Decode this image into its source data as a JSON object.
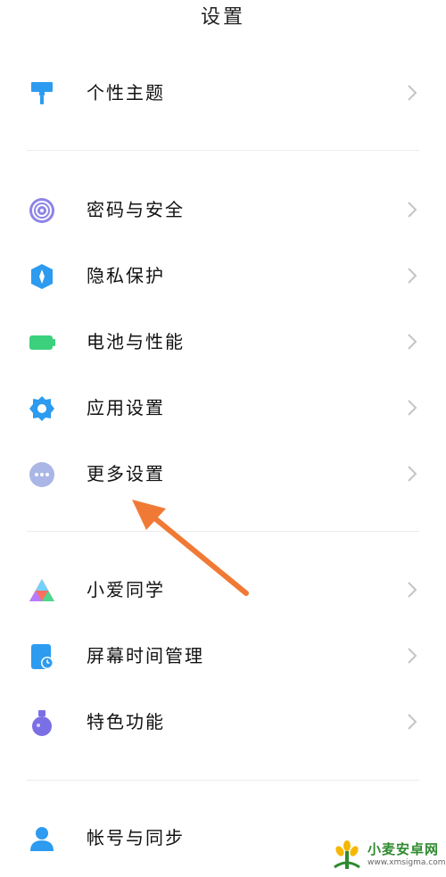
{
  "header": {
    "title": "设置"
  },
  "sections": [
    {
      "items": [
        {
          "label": "个性主题",
          "icon": "paint-brush-icon"
        }
      ]
    },
    {
      "items": [
        {
          "label": "密码与安全",
          "icon": "fingerprint-icon"
        },
        {
          "label": "隐私保护",
          "icon": "privacy-shield-icon"
        },
        {
          "label": "电池与性能",
          "icon": "battery-icon"
        },
        {
          "label": "应用设置",
          "icon": "gear-icon"
        },
        {
          "label": "更多设置",
          "icon": "more-dots-icon"
        }
      ]
    },
    {
      "items": [
        {
          "label": "小爱同学",
          "icon": "xiaoai-icon"
        },
        {
          "label": "屏幕时间管理",
          "icon": "screen-time-icon"
        },
        {
          "label": "特色功能",
          "icon": "flask-icon"
        }
      ]
    },
    {
      "items": [
        {
          "label": "帐号与同步",
          "icon": "user-icon"
        }
      ]
    }
  ],
  "annotation": {
    "arrow_color": "#f07a35",
    "points_to": "更多设置"
  },
  "watermark": {
    "brand": "小麦安卓网",
    "url": "www.xmsigma.com"
  },
  "colors": {
    "accent_blue": "#2c9bf0",
    "battery_green": "#3ad07c",
    "divider": "#ececec",
    "chevron": "#c4c4c4"
  }
}
